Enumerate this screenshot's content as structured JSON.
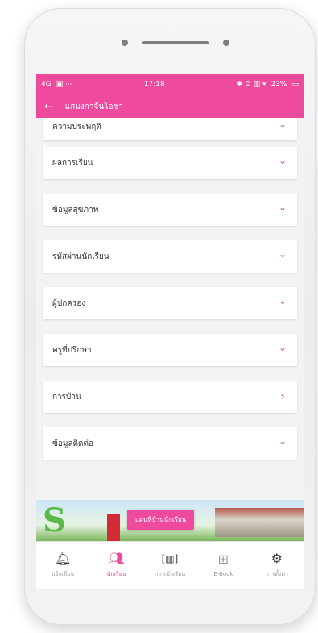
{
  "status_bar": {
    "signal": "4G",
    "time": "17:18",
    "battery": "23%"
  },
  "app_bar": {
    "title": "แสมงกาจันโอชา"
  },
  "accordion_items": [
    {
      "label": "ความประพฤติ",
      "chevron": "down"
    },
    {
      "label": "ผลการเรียน",
      "chevron": "down"
    },
    {
      "label": "ข้อมูลสุขภาพ",
      "chevron": "down"
    },
    {
      "label": "รหัสผ่านนักเรียน",
      "chevron": "down"
    },
    {
      "label": "ผู้ปกครอง",
      "chevron": "down"
    },
    {
      "label": "ครูที่ปรึกษา",
      "chevron": "down"
    },
    {
      "label": "การบ้าน",
      "chevron": "right"
    },
    {
      "label": "ข้อมูลติดต่อ",
      "chevron": "down"
    }
  ],
  "banner": {
    "button_label": "แผนที่บ้านนักเรียน"
  },
  "bottom_nav": [
    {
      "label": "แจ้งเตือน",
      "icon": "bell-icon"
    },
    {
      "label": "นักเรียน",
      "icon": "students-icon",
      "active": true
    },
    {
      "label": "การเข้าเรียน",
      "icon": "barcode-icon"
    },
    {
      "label": "E-Book",
      "icon": "book-icon"
    },
    {
      "label": "การตั้งค่า",
      "icon": "gear-icon"
    }
  ],
  "colors": {
    "accent": "#ee4a9e",
    "background": "#f3f3f4"
  }
}
